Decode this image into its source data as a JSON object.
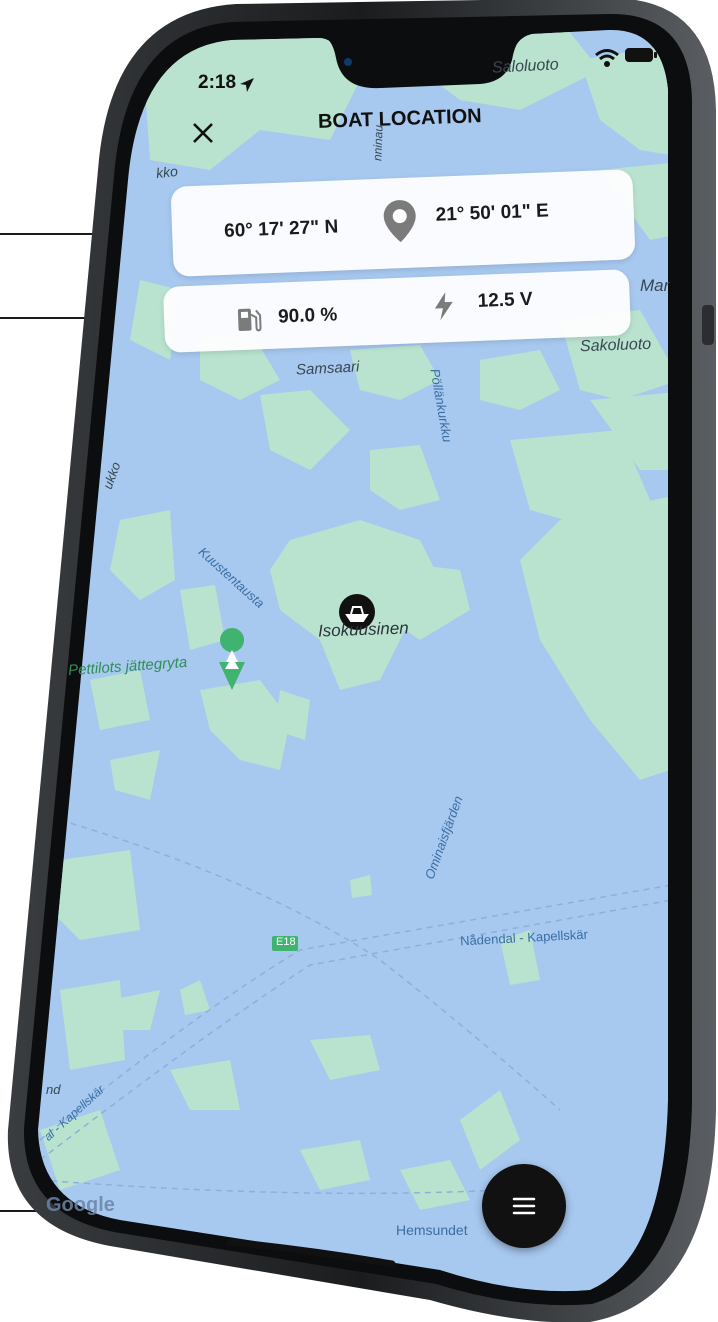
{
  "status_bar": {
    "time": "2:18",
    "location_arrow": "location-arrow-icon",
    "wifi": "wifi-icon",
    "battery": "battery-icon"
  },
  "header": {
    "title": "BOAT LOCATION",
    "close_icon": "close-icon"
  },
  "coordinates": {
    "latitude": "60° 17' 27\" N",
    "longitude": "21° 50' 01\" E",
    "icon": "location-pin-icon"
  },
  "vitals": {
    "fuel_value": "90.0 %",
    "fuel_icon": "fuel-pump-icon",
    "voltage_value": "12.5 V",
    "voltage_icon": "lightning-icon"
  },
  "map": {
    "labels": {
      "saloluoto": "Saloluoto",
      "sakoluoto": "Sakoluoto",
      "mar": "Mar",
      "samsaari": "Samsaari",
      "pollankurkku": "Pöllänkurkku",
      "kuustentausta": "Kuustentausta",
      "island": "Isokuusinen",
      "poi": "Pettilots jättegryta",
      "ominaisfjarden": "Ominaisfjärden",
      "route": "Nådendal - Kapellskär",
      "route2": "al - Kapellskär",
      "road": "E18",
      "hemsundet": "Hemsundet",
      "kko": "kko",
      "ukko": "ukko",
      "nninaukko": "nninau",
      "und": "nd"
    },
    "attribution": "Google",
    "boat_marker_icon": "boat-icon",
    "poi_icon": "tree-pin-icon",
    "colors": {
      "water": "#a7c8ef",
      "land": "#b9e3cf",
      "marker": "#111111",
      "poi": "#3fb36f"
    }
  },
  "fab": {
    "icon": "menu-icon"
  }
}
